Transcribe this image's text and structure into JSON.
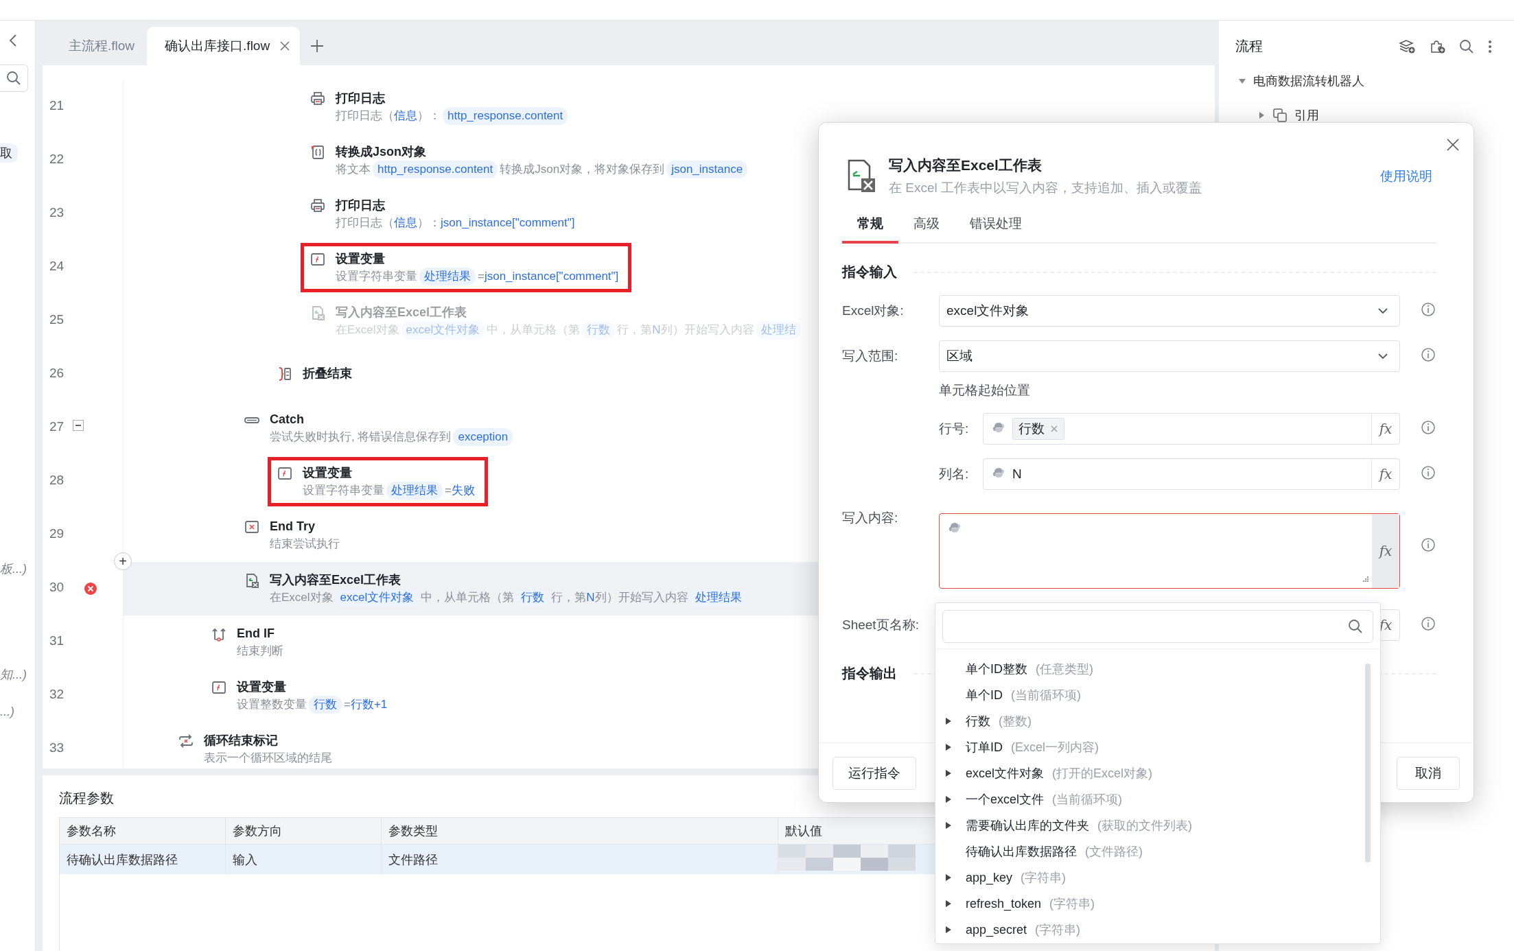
{
  "left_panel": {
    "fragments": [
      "取",
      "板...)",
      "知...)",
      "...)"
    ]
  },
  "tabs": [
    {
      "label": "主流程.flow",
      "selected": false,
      "closable": false
    },
    {
      "label": "确认出库接口.flow",
      "selected": true,
      "closable": true
    }
  ],
  "editor": {
    "lines": [
      {
        "children": [
          {
            "children": [
              {
                "children": [
                  {
                    "children": [
                      {
                        "line": "21",
                        "kind": "print",
                        "title": "打印日志",
                        "desc": [
                          {
                            "kind": "text",
                            "text": "打印日志（"
                          },
                          {
                            "kind": "value",
                            "text": "信息"
                          },
                          {
                            "kind": "text",
                            "text": "）："
                          },
                          {
                            "kind": "chip",
                            "text": "http_response.content"
                          }
                        ],
                        "disabled": false,
                        "highlighted": false,
                        "selected": false,
                        "error": false
                      },
                      {
                        "line": "22",
                        "kind": "json",
                        "title": "转换成Json对象",
                        "desc": [
                          {
                            "kind": "text",
                            "text": "将文本"
                          },
                          {
                            "kind": "chip",
                            "text": "http_response.content"
                          },
                          {
                            "kind": "text",
                            "text": "转换成Json对象，将对象保存到"
                          },
                          {
                            "kind": "chip",
                            "text": "json_instance"
                          }
                        ],
                        "disabled": false,
                        "highlighted": false,
                        "selected": false,
                        "error": false
                      },
                      {
                        "line": "23",
                        "kind": "print",
                        "title": "打印日志",
                        "desc": [
                          {
                            "kind": "text",
                            "text": "打印日志（"
                          },
                          {
                            "kind": "value",
                            "text": "信息"
                          },
                          {
                            "kind": "text",
                            "text": "）："
                          },
                          {
                            "kind": "value",
                            "text": "json_instance[\"comment\"]"
                          }
                        ],
                        "disabled": false,
                        "highlighted": false,
                        "selected": false,
                        "error": false
                      },
                      {
                        "line": "24",
                        "kind": "setvar",
                        "title": "设置变量",
                        "desc": [
                          {
                            "kind": "text",
                            "text": "设置字符串变量"
                          },
                          {
                            "kind": "chip",
                            "text": "处理结果"
                          },
                          {
                            "kind": "text",
                            "text": "="
                          },
                          {
                            "kind": "value",
                            "text": "json_instance[\"comment\"]"
                          }
                        ],
                        "disabled": false,
                        "highlighted": true,
                        "selected": false,
                        "error": false
                      },
                      {
                        "line": "25",
                        "kind": "excel",
                        "title": "写入内容至Excel工作表",
                        "desc": [
                          {
                            "kind": "text",
                            "text": "在Excel对象"
                          },
                          {
                            "kind": "chip",
                            "text": "excel文件对象"
                          },
                          {
                            "kind": "text",
                            "text": "中，从单元格（第"
                          },
                          {
                            "kind": "chip",
                            "text": "行数"
                          },
                          {
                            "kind": "text",
                            "text": "行，第"
                          },
                          {
                            "kind": "value",
                            "text": "N"
                          },
                          {
                            "kind": "text",
                            "text": "列）开始写入内容"
                          },
                          {
                            "kind": "chip",
                            "text": "处理结"
                          }
                        ],
                        "disabled": true,
                        "highlighted": false,
                        "selected": false,
                        "error": false
                      }
                    ]
                  },
                  {
                    "line": "26",
                    "kind": "fold-end",
                    "title": "折叠结束",
                    "disabled": false,
                    "highlighted": false,
                    "selected": false,
                    "error": false
                  }
                ]
              },
              {
                "line": "27",
                "kind": "catch",
                "title": "Catch",
                "expanded": true,
                "desc": [
                  {
                    "kind": "text",
                    "text": "尝试失败时执行, 将错误信息保存到"
                  },
                  {
                    "kind": "chip",
                    "text": "exception"
                  }
                ],
                "disabled": false,
                "highlighted": false,
                "selected": false,
                "error": false,
                "children": [
                  {
                    "line": "28",
                    "kind": "setvar",
                    "title": "设置变量",
                    "desc": [
                      {
                        "kind": "text",
                        "text": "设置字符串变量"
                      },
                      {
                        "kind": "chip",
                        "text": "处理结果"
                      },
                      {
                        "kind": "text",
                        "text": "="
                      },
                      {
                        "kind": "value",
                        "text": "失败"
                      }
                    ],
                    "disabled": false,
                    "highlighted": true,
                    "selected": false,
                    "error": false
                  }
                ]
              },
              {
                "line": "29",
                "kind": "endtry",
                "title": "End Try",
                "desc": [
                  {
                    "kind": "text",
                    "text": "结束尝试执行"
                  }
                ],
                "disabled": false,
                "highlighted": false,
                "selected": false,
                "error": false
              },
              {
                "line": "30",
                "kind": "excel",
                "title": "写入内容至Excel工作表",
                "add_button": "+",
                "desc": [
                  {
                    "kind": "text",
                    "text": "在Excel对象"
                  },
                  {
                    "kind": "chip",
                    "text": "excel文件对象"
                  },
                  {
                    "kind": "text",
                    "text": "中，从单元格（第"
                  },
                  {
                    "kind": "chip",
                    "text": "行数"
                  },
                  {
                    "kind": "text",
                    "text": "行，第"
                  },
                  {
                    "kind": "value",
                    "text": "N"
                  },
                  {
                    "kind": "text",
                    "text": "列）开始写入内容"
                  },
                  {
                    "kind": "chip",
                    "text": "处理结果"
                  }
                ],
                "disabled": false,
                "highlighted": false,
                "selected": true,
                "error": true
              }
            ]
          },
          {
            "line": "31",
            "kind": "endif",
            "title": "End IF",
            "desc": [
              {
                "kind": "text",
                "text": "结束判断"
              }
            ],
            "disabled": false,
            "highlighted": false,
            "selected": false,
            "error": false
          },
          {
            "line": "32",
            "kind": "setvar",
            "title": "设置变量",
            "desc": [
              {
                "kind": "text",
                "text": "设置整数变量"
              },
              {
                "kind": "chip",
                "text": "行数"
              },
              {
                "kind": "text",
                "text": "="
              },
              {
                "kind": "value",
                "text": "行数+1"
              }
            ],
            "disabled": false,
            "highlighted": false,
            "selected": false,
            "error": false
          }
        ]
      },
      {
        "line": "33",
        "kind": "loop-end",
        "title": "循环结束标记",
        "desc": [
          {
            "kind": "text",
            "text": "表示一个循环区域的结尾"
          }
        ],
        "disabled": false,
        "highlighted": false,
        "selected": false,
        "error": false
      }
    ]
  },
  "params": {
    "title": "流程参数",
    "columns": [
      "参数名称",
      "参数方向",
      "参数类型",
      "默认值"
    ],
    "rows": [
      {
        "cells": [
          "待确认出库数据路径",
          "输入",
          "文件路径"
        ],
        "selected": true
      }
    ]
  },
  "side_panel": {
    "title": "流程",
    "tree": [
      {
        "label": "电商数据流转机器人",
        "expanded": true,
        "children": [
          {
            "label": "引用",
            "expanded": false
          }
        ]
      }
    ]
  },
  "dialog": {
    "title": "写入内容至Excel工作表",
    "subtitle": "在 Excel 工作表中以写入内容，支持追加、插入或覆盖",
    "help_link": "使用说明",
    "tabs": [
      {
        "label": "常规",
        "selected": true
      },
      {
        "label": "高级",
        "selected": false
      },
      {
        "label": "错误处理",
        "selected": false
      }
    ],
    "input_section": "指令输入",
    "fields": [
      {
        "kind": "select",
        "label": "Excel对象:",
        "value": "excel文件对象",
        "sub": false
      },
      {
        "kind": "select",
        "label": "写入范围:",
        "value": "区域",
        "sub": false
      },
      {
        "kind": "caption",
        "label": "单元格起始位置",
        "sub": false
      },
      {
        "kind": "tag-input",
        "label": "行号:",
        "tag": "行数",
        "fx": "fx",
        "sub": true
      },
      {
        "kind": "text-input",
        "label": "列名:",
        "value": "N",
        "fx": "fx",
        "sub": true
      },
      {
        "kind": "textarea",
        "label": "写入内容:",
        "fx": "fx",
        "invalid": true,
        "sub": false
      },
      {
        "kind": "sheet-input",
        "label": "Sheet页名称:",
        "fx": "fx",
        "sub": false
      }
    ],
    "output_section": "指令输出",
    "run_button": "运行指令",
    "cancel_button": "取消"
  },
  "dropdown": {
    "items": [
      {
        "name": "单个ID整数",
        "type": "(任意类型)",
        "expandable": false
      },
      {
        "name": "单个ID",
        "type": "(当前循环项)",
        "expandable": false
      },
      {
        "name": "行数",
        "type": "(整数)",
        "expandable": true
      },
      {
        "name": "订单ID",
        "type": "(Excel一列内容)",
        "expandable": true
      },
      {
        "name": "excel文件对象",
        "type": "(打开的Excel对象)",
        "expandable": true
      },
      {
        "name": "一个excel文件",
        "type": "(当前循环项)",
        "expandable": true
      },
      {
        "name": "需要确认出库的文件夹",
        "type": "(获取的文件列表)",
        "expandable": true
      },
      {
        "name": "待确认出库数据路径",
        "type": "(文件路径)",
        "expandable": false
      },
      {
        "name": "app_key",
        "type": "(字符串)",
        "expandable": true
      },
      {
        "name": "refresh_token",
        "type": "(字符串)",
        "expandable": true
      },
      {
        "name": "app_secret",
        "type": "(字符串)",
        "expandable": true
      }
    ]
  }
}
